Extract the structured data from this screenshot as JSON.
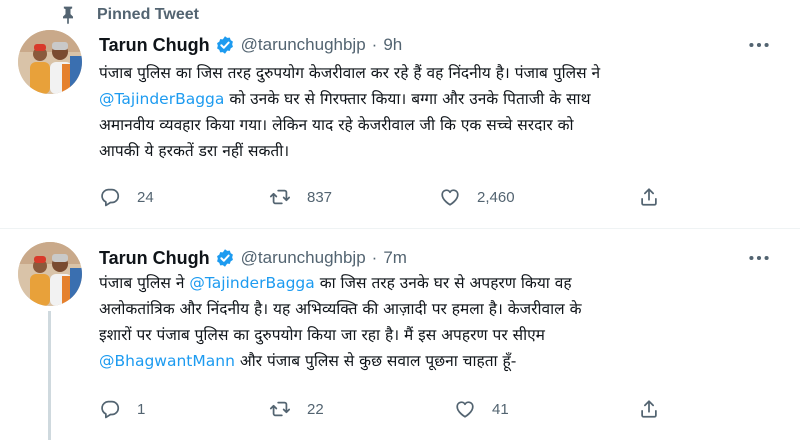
{
  "pinned": {
    "label": "Pinned Tweet"
  },
  "tweets": [
    {
      "author": {
        "name": "Tarun Chugh",
        "handle": "@tarunchughbjp"
      },
      "time": "9h",
      "lines": [
        [
          "पंजाब पुलिस का जिस तरह दुरुपयोग केजरीवाल कर रहे हैं वह निंदनीय है। पंजाब पुलिस ने"
        ],
        [
          "@TajinderBagga",
          " को उनके घर से गिरफ्तार किया। बग्गा और उनके पिताजी के साथ"
        ],
        [
          "अमानवीय व्यवहार किया गया। लेकिन याद रहे केजरीवाल जी कि एक सच्चे सरदार को"
        ],
        [
          "आपकी ये हरकतें डरा नहीं सकती।"
        ]
      ],
      "replies": "24",
      "retweets": "837",
      "likes": "2,460"
    },
    {
      "author": {
        "name": "Tarun Chugh",
        "handle": "@tarunchughbjp"
      },
      "time": "7m",
      "lines": [
        [
          "पंजाब पुलिस ने ",
          "@TajinderBagga",
          " का जिस तरह उनके घर से अपहरण किया वह"
        ],
        [
          "अलोकतांत्रिक और निंदनीय है। यह अभिव्यक्ति की आज़ादी पर हमला है। केजरीवाल के"
        ],
        [
          "इशारों पर पंजाब पुलिस का दुरुपयोग किया जा रहा है। मैं इस अपहरण पर सीएम"
        ],
        [
          "@BhagwantMann",
          " और पंजाब पुलिस से कुछ सवाल पूछना चाहता हूँ-"
        ]
      ],
      "replies": "1",
      "retweets": "22",
      "likes": "41"
    }
  ],
  "colors": {
    "accent": "#1d9bf0",
    "secondary_text": "#536471",
    "primary_text": "#0f1419",
    "retweet_green": "#536471"
  },
  "icons": [
    "pin-icon",
    "verified-badge-icon",
    "more-options-icon",
    "reply-icon",
    "retweet-icon",
    "like-icon",
    "share-icon"
  ]
}
